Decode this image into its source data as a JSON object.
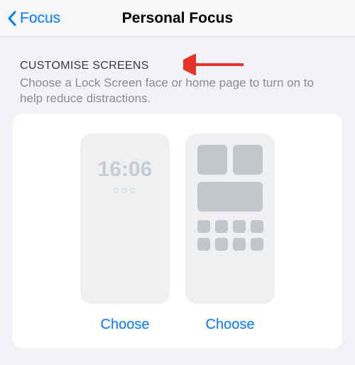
{
  "nav": {
    "back_label": "Focus",
    "title": "Personal Focus"
  },
  "section": {
    "header": "CUSTOMISE SCREENS",
    "subtitle": "Choose a Lock Screen face or home page to turn on to help reduce distractions."
  },
  "previews": {
    "lock_screen": {
      "time": "16:06",
      "dots": "○○○",
      "choose_label": "Choose"
    },
    "home_screen": {
      "choose_label": "Choose"
    }
  },
  "annotation": {
    "arrow_color": "#e53328"
  }
}
